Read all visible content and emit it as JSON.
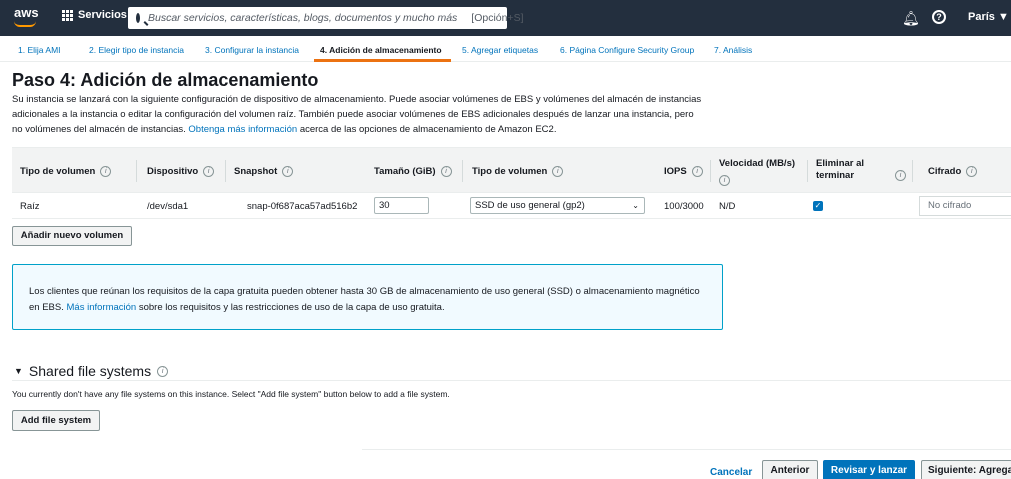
{
  "topnav": {
    "logo": "aws",
    "services_label": "Servicios",
    "search_placeholder": "Buscar servicios, características, blogs, documentos y mucho más",
    "search_shortcut": "[Opción+S]",
    "region": "París ▼",
    "icons": [
      "bell-icon",
      "help-icon"
    ]
  },
  "steps": [
    {
      "label": "1. Elija AMI",
      "active": false
    },
    {
      "label": "2. Elegir tipo de instancia",
      "active": false
    },
    {
      "label": "3. Configurar la instancia",
      "active": false
    },
    {
      "label": "4. Adición de almacenamiento",
      "active": true
    },
    {
      "label": "5. Agregar etiquetas",
      "active": false
    },
    {
      "label": "6. Página Configure Security Group",
      "active": false
    },
    {
      "label": "7. Análisis",
      "active": false
    }
  ],
  "page": {
    "title": "Paso 4: Adición de almacenamiento",
    "intro_text": "Su instancia se lanzará con la siguiente configuración de dispositivo de almacenamiento. Puede asociar volúmenes de EBS y volúmenes del almacén de instancias adicionales a la instancia o editar la configuración del volumen raíz. También puede asociar volúmenes de EBS adicionales después de lanzar una instancia, pero no volúmenes del almacén de instancias.",
    "intro_link": "Obtenga más información",
    "intro_suffix": "acerca de las opciones de almacenamiento de Amazon EC2."
  },
  "table": {
    "headers": [
      "Tipo de volumen",
      "Dispositivo",
      "Snapshot",
      "Tamaño (GiB)",
      "Tipo de volumen",
      "IOPS",
      "Velocidad (MB/s)",
      "Eliminar al terminar",
      "Cifrado"
    ],
    "row": {
      "volume_type": "Raíz",
      "device": "/dev/sda1",
      "snapshot": "snap-0f687aca57ad516b2",
      "size": "30",
      "volume_kind": "SSD de uso general (gp2)",
      "iops": "100/3000",
      "throughput": "N/D",
      "delete_on_termination": true,
      "encryption": "No cifrado"
    }
  },
  "add_volume_label": "Añadir nuevo volumen",
  "info_box": {
    "text": "Los clientes que reúnan los requisitos de la capa gratuita pueden obtener hasta 30 GB de almacenamiento de uso general (SSD) o almacenamiento magnético en EBS.",
    "link": "Más información",
    "suffix": "sobre los requisitos y las restricciones de uso de la capa de uso gratuita."
  },
  "shared_fs": {
    "title": "Shared file systems",
    "description": "You currently don't have any file systems on this instance. Select \"Add file system\" button below to add a file system.",
    "add_label": "Add file system"
  },
  "footer": {
    "cancel": "Cancelar",
    "previous": "Anterior",
    "review": "Revisar y lanzar",
    "next": "Siguiente: Agregar"
  }
}
